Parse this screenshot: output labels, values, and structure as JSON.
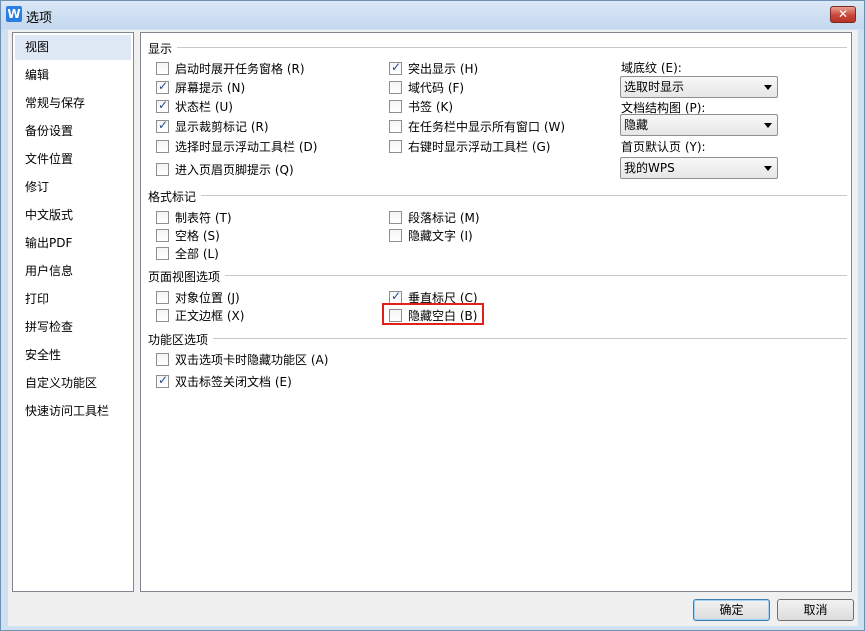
{
  "window": {
    "title": "选项",
    "app_icon_glyph": "W",
    "close_glyph": "✕"
  },
  "sidebar": {
    "selected_index": 0,
    "items": [
      {
        "label": "视图"
      },
      {
        "label": "编辑"
      },
      {
        "label": "常规与保存"
      },
      {
        "label": "备份设置"
      },
      {
        "label": "文件位置"
      },
      {
        "label": "修订"
      },
      {
        "label": "中文版式"
      },
      {
        "label": "输出PDF"
      },
      {
        "label": "用户信息"
      },
      {
        "label": "打印"
      },
      {
        "label": "拼写检查"
      },
      {
        "label": "安全性"
      },
      {
        "label": "自定义功能区"
      },
      {
        "label": "快速访问工具栏"
      }
    ]
  },
  "display": {
    "heading": "显示",
    "col1": [
      {
        "label": "启动时展开任务窗格 (R)",
        "checked": false
      },
      {
        "label": "屏幕提示 (N)",
        "checked": true
      },
      {
        "label": "状态栏 (U)",
        "checked": true
      },
      {
        "label": "显示裁剪标记 (R)",
        "checked": true
      },
      {
        "label": "选择时显示浮动工具栏 (D)",
        "checked": false
      },
      {
        "label": "进入页眉页脚提示 (Q)",
        "checked": false
      }
    ],
    "col2": [
      {
        "label": "突出显示 (H)",
        "checked": true
      },
      {
        "label": "域代码 (F)",
        "checked": false
      },
      {
        "label": "书签 (K)",
        "checked": false
      },
      {
        "label": "在任务栏中显示所有窗口 (W)",
        "checked": false
      },
      {
        "label": "右键时显示浮动工具栏 (G)",
        "checked": false
      }
    ],
    "field_shading": {
      "label": "域底纹 (E):",
      "value": "选取时显示"
    },
    "doc_structure": {
      "label": "文档结构图 (P):",
      "value": "隐藏"
    },
    "home_default": {
      "label": "首页默认页 (Y):",
      "value": "我的WPS"
    }
  },
  "format_marks": {
    "heading": "格式标记",
    "col1": [
      {
        "label": "制表符 (T)",
        "checked": false
      },
      {
        "label": "空格 (S)",
        "checked": false
      },
      {
        "label": "全部 (L)",
        "checked": false
      }
    ],
    "col2": [
      {
        "label": "段落标记 (M)",
        "checked": false
      },
      {
        "label": "隐藏文字 (I)",
        "checked": false
      }
    ]
  },
  "page_view": {
    "heading": "页面视图选项",
    "col1": [
      {
        "label": "对象位置 (J)",
        "checked": false
      },
      {
        "label": "正文边框 (X)",
        "checked": false
      }
    ],
    "col2": [
      {
        "label": "垂直标尺 (C)",
        "checked": true
      },
      {
        "label": "隐藏空白 (B)",
        "checked": false
      }
    ]
  },
  "ribbon": {
    "heading": "功能区选项",
    "items": [
      {
        "label": "双击选项卡时隐藏功能区 (A)",
        "checked": false
      },
      {
        "label": "双击标签关闭文档 (E)",
        "checked": true
      }
    ]
  },
  "buttons": {
    "ok": "确定",
    "cancel": "取消"
  },
  "colors": {
    "highlight_border": "#e0201a",
    "selected_sidebar": "#dfe8f5"
  }
}
